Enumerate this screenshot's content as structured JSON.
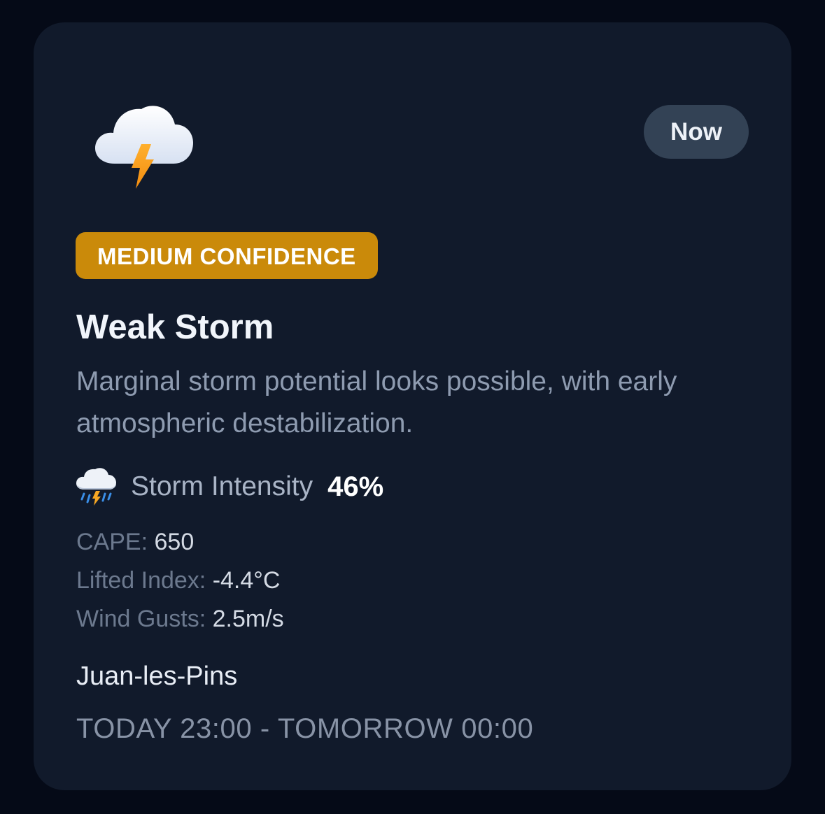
{
  "alert": {
    "weather_icon": "thunderstorm-cloud-icon",
    "time_pill": "Now",
    "confidence": "MEDIUM CONFIDENCE",
    "confidence_color": "#ca8a0a",
    "title": "Weak Storm",
    "description": "Marginal storm potential looks possible, with early atmospheric destabilization.",
    "intensity": {
      "icon": "cloud-rain-lightning-icon",
      "label": "Storm Intensity",
      "value": "46%"
    },
    "metrics": [
      {
        "key": "CAPE:",
        "value": "650"
      },
      {
        "key": "Lifted Index:",
        "value": "-4.4°C"
      },
      {
        "key": "Wind Gusts:",
        "value": "2.5m/s"
      }
    ],
    "location": "Juan-les-Pins",
    "time_range": "TODAY 23:00 - TOMORROW 00:00"
  }
}
